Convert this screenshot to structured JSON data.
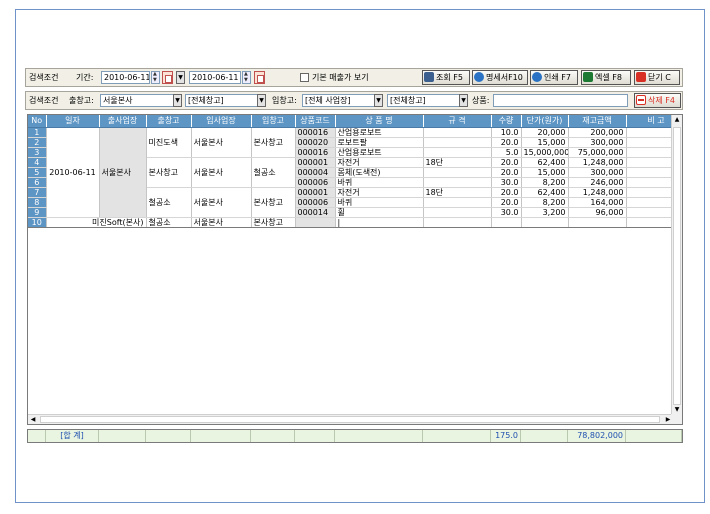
{
  "colors": {
    "header_blue": "#5d95c4",
    "total_green": "#e9f5e1",
    "danger": "#d93025"
  },
  "search1": {
    "section_label": "검색조건",
    "period_label": "기간:",
    "date_from": "2010-06-11",
    "date_to": "2010-06-11",
    "base_checkbox_label": "기본 매출가 보기",
    "buttons": {
      "query": "조회 F5",
      "detail": "명세서F10",
      "print": "인쇄 F7",
      "excel": "엑셀 F8",
      "close": "닫기 C"
    }
  },
  "search2": {
    "section_label": "검색조건",
    "out_label": "출창고:",
    "out_value": "서울본사",
    "out_wh_value": "[전체창고]",
    "in_label": "입창고:",
    "in_value": "[전체 사업장]",
    "in_wh_value": "[전체창고]",
    "product_label": "상품:",
    "product_value": "",
    "delete_button": "삭제 F4"
  },
  "grid": {
    "columns": [
      "No",
      "일자",
      "출사업장",
      "출창고",
      "입사업장",
      "입창고",
      "상품코드",
      "상 품 명",
      "규 격",
      "수량",
      "단가(원가)",
      "재고금액",
      "비 고"
    ],
    "merged": {
      "date": "2010-06-11",
      "out_site_main": "서울본사",
      "row10_out_site": "미진Soft(본사)",
      "groups": [
        {
          "out_wh": "미진도색",
          "in_site": "서울본사",
          "in_wh": "본사창고"
        },
        {
          "out_wh": "본사창고",
          "in_site": "서울본사",
          "in_wh": "철공소"
        },
        {
          "out_wh": "철공소",
          "in_site": "서울본사",
          "in_wh": "본사창고"
        },
        {
          "out_wh": "철공소",
          "in_site": "서울본사",
          "in_wh": "본사창고"
        }
      ]
    },
    "rows": [
      {
        "no": "1",
        "code": "000016",
        "name": "산업용로보트",
        "spec": "",
        "qty": "10.0",
        "price": "20,000",
        "amount": "200,000"
      },
      {
        "no": "2",
        "code": "000020",
        "name": "로보트팔",
        "spec": "",
        "qty": "20.0",
        "price": "15,000",
        "amount": "300,000"
      },
      {
        "no": "3",
        "code": "000016",
        "name": "산업용로보트",
        "spec": "",
        "qty": "5.0",
        "price": "15,000,000",
        "amount": "75,000,000"
      },
      {
        "no": "4",
        "code": "000001",
        "name": "자전거",
        "spec": "18단",
        "qty": "20.0",
        "price": "62,400",
        "amount": "1,248,000"
      },
      {
        "no": "5",
        "code": "000004",
        "name": "몸체(도색전)",
        "spec": "",
        "qty": "20.0",
        "price": "15,000",
        "amount": "300,000"
      },
      {
        "no": "6",
        "code": "000006",
        "name": "바퀴",
        "spec": "",
        "qty": "30.0",
        "price": "8,200",
        "amount": "246,000"
      },
      {
        "no": "7",
        "code": "000001",
        "name": "자전거",
        "spec": "18단",
        "qty": "20.0",
        "price": "62,400",
        "amount": "1,248,000"
      },
      {
        "no": "8",
        "code": "000006",
        "name": "바퀴",
        "spec": "",
        "qty": "20.0",
        "price": "8,200",
        "amount": "164,000"
      },
      {
        "no": "9",
        "code": "000014",
        "name": "휠",
        "spec": "",
        "qty": "30.0",
        "price": "3,200",
        "amount": "96,000"
      },
      {
        "no": "10",
        "code": "",
        "name": "|",
        "spec": "",
        "qty": "",
        "price": "",
        "amount": ""
      }
    ]
  },
  "total": {
    "label": "[합 계]",
    "qty": "175.0",
    "amount": "78,802,000"
  }
}
